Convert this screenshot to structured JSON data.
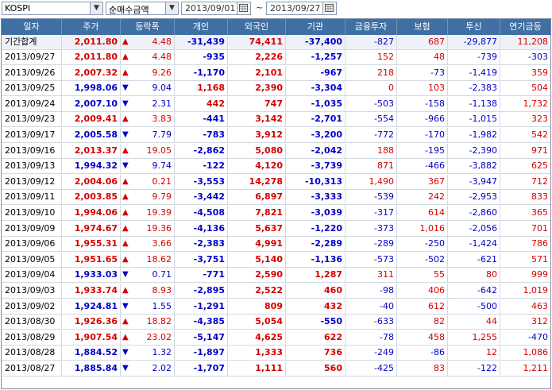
{
  "toolbar": {
    "market": "KOSPI",
    "metric": "순매수금액",
    "date_from": "2013/09/01",
    "date_to": "2013/09/27",
    "separator": "~"
  },
  "columns": [
    "일자",
    "주가",
    "등락폭",
    "개인",
    "외국인",
    "기관",
    "금융투자",
    "보험",
    "투신",
    "연기금등"
  ],
  "colors": {
    "up": "#d40000",
    "down": "#0000c8",
    "header_bg": "#3f6fa3"
  },
  "summary": {
    "label": "기간합계",
    "price": "2,011.80",
    "dir": "up",
    "change": "4.48",
    "individual": "-31,439",
    "foreign": "74,411",
    "institution": "-37,400",
    "fin_invest": "-827",
    "insurance": "687",
    "trust": "-29,877",
    "pension": "11,208"
  },
  "rows": [
    {
      "date": "2013/09/27",
      "price": "2,011.80",
      "dir": "up",
      "change": "4.48",
      "individual": "-935",
      "foreign": "2,226",
      "institution": "-1,257",
      "fin_invest": "152",
      "insurance": "48",
      "trust": "-739",
      "pension": "-303"
    },
    {
      "date": "2013/09/26",
      "price": "2,007.32",
      "dir": "up",
      "change": "9.26",
      "individual": "-1,170",
      "foreign": "2,101",
      "institution": "-967",
      "fin_invest": "218",
      "insurance": "-73",
      "trust": "-1,419",
      "pension": "359"
    },
    {
      "date": "2013/09/25",
      "price": "1,998.06",
      "dir": "down",
      "change": "9.04",
      "individual": "1,168",
      "foreign": "2,390",
      "institution": "-3,304",
      "fin_invest": "0",
      "insurance": "103",
      "trust": "-2,383",
      "pension": "504"
    },
    {
      "date": "2013/09/24",
      "price": "2,007.10",
      "dir": "down",
      "change": "2.31",
      "individual": "442",
      "foreign": "747",
      "institution": "-1,035",
      "fin_invest": "-503",
      "insurance": "-158",
      "trust": "-1,138",
      "pension": "1,732"
    },
    {
      "date": "2013/09/23",
      "price": "2,009.41",
      "dir": "up",
      "change": "3.83",
      "individual": "-441",
      "foreign": "3,142",
      "institution": "-2,701",
      "fin_invest": "-554",
      "insurance": "-966",
      "trust": "-1,015",
      "pension": "323"
    },
    {
      "date": "2013/09/17",
      "price": "2,005.58",
      "dir": "down",
      "change": "7.79",
      "individual": "-783",
      "foreign": "3,912",
      "institution": "-3,200",
      "fin_invest": "-772",
      "insurance": "-170",
      "trust": "-1,982",
      "pension": "542"
    },
    {
      "date": "2013/09/16",
      "price": "2,013.37",
      "dir": "up",
      "change": "19.05",
      "individual": "-2,862",
      "foreign": "5,080",
      "institution": "-2,042",
      "fin_invest": "188",
      "insurance": "-195",
      "trust": "-2,390",
      "pension": "971"
    },
    {
      "date": "2013/09/13",
      "price": "1,994.32",
      "dir": "down",
      "change": "9.74",
      "individual": "-122",
      "foreign": "4,120",
      "institution": "-3,739",
      "fin_invest": "871",
      "insurance": "-466",
      "trust": "-3,882",
      "pension": "625"
    },
    {
      "date": "2013/09/12",
      "price": "2,004.06",
      "dir": "up",
      "change": "0.21",
      "individual": "-3,553",
      "foreign": "14,278",
      "institution": "-10,313",
      "fin_invest": "1,490",
      "insurance": "367",
      "trust": "-3,947",
      "pension": "712"
    },
    {
      "date": "2013/09/11",
      "price": "2,003.85",
      "dir": "up",
      "change": "9.79",
      "individual": "-3,442",
      "foreign": "6,897",
      "institution": "-3,333",
      "fin_invest": "-539",
      "insurance": "242",
      "trust": "-2,953",
      "pension": "833"
    },
    {
      "date": "2013/09/10",
      "price": "1,994.06",
      "dir": "up",
      "change": "19.39",
      "individual": "-4,508",
      "foreign": "7,821",
      "institution": "-3,039",
      "fin_invest": "-317",
      "insurance": "614",
      "trust": "-2,860",
      "pension": "365"
    },
    {
      "date": "2013/09/09",
      "price": "1,974.67",
      "dir": "up",
      "change": "19.36",
      "individual": "-4,136",
      "foreign": "5,637",
      "institution": "-1,220",
      "fin_invest": "-373",
      "insurance": "1,016",
      "trust": "-2,056",
      "pension": "701"
    },
    {
      "date": "2013/09/06",
      "price": "1,955.31",
      "dir": "up",
      "change": "3.66",
      "individual": "-2,383",
      "foreign": "4,991",
      "institution": "-2,289",
      "fin_invest": "-289",
      "insurance": "-250",
      "trust": "-1,424",
      "pension": "786"
    },
    {
      "date": "2013/09/05",
      "price": "1,951.65",
      "dir": "up",
      "change": "18.62",
      "individual": "-3,751",
      "foreign": "5,140",
      "institution": "-1,136",
      "fin_invest": "-573",
      "insurance": "-502",
      "trust": "-621",
      "pension": "571"
    },
    {
      "date": "2013/09/04",
      "price": "1,933.03",
      "dir": "down",
      "change": "0.71",
      "individual": "-771",
      "foreign": "2,590",
      "institution": "1,287",
      "fin_invest": "311",
      "insurance": "55",
      "trust": "80",
      "pension": "999"
    },
    {
      "date": "2013/09/03",
      "price": "1,933.74",
      "dir": "up",
      "change": "8.93",
      "individual": "-2,895",
      "foreign": "2,522",
      "institution": "460",
      "fin_invest": "-98",
      "insurance": "406",
      "trust": "-642",
      "pension": "1,019"
    },
    {
      "date": "2013/09/02",
      "price": "1,924.81",
      "dir": "down",
      "change": "1.55",
      "individual": "-1,291",
      "foreign": "809",
      "institution": "432",
      "fin_invest": "-40",
      "insurance": "612",
      "trust": "-500",
      "pension": "463"
    },
    {
      "date": "2013/08/30",
      "price": "1,926.36",
      "dir": "up",
      "change": "18.82",
      "individual": "-4,385",
      "foreign": "5,054",
      "institution": "-550",
      "fin_invest": "-633",
      "insurance": "82",
      "trust": "44",
      "pension": "312"
    },
    {
      "date": "2013/08/29",
      "price": "1,907.54",
      "dir": "up",
      "change": "23.02",
      "individual": "-5,147",
      "foreign": "4,625",
      "institution": "622",
      "fin_invest": "-78",
      "insurance": "458",
      "trust": "1,255",
      "pension": "-470"
    },
    {
      "date": "2013/08/28",
      "price": "1,884.52",
      "dir": "down",
      "change": "1.32",
      "individual": "-1,897",
      "foreign": "1,333",
      "institution": "736",
      "fin_invest": "-249",
      "insurance": "-86",
      "trust": "12",
      "pension": "1,086"
    },
    {
      "date": "2013/08/27",
      "price": "1,885.84",
      "dir": "down",
      "change": "2.02",
      "individual": "-1,707",
      "foreign": "1,111",
      "institution": "560",
      "fin_invest": "-425",
      "insurance": "83",
      "trust": "-122",
      "pension": "1,211"
    }
  ]
}
